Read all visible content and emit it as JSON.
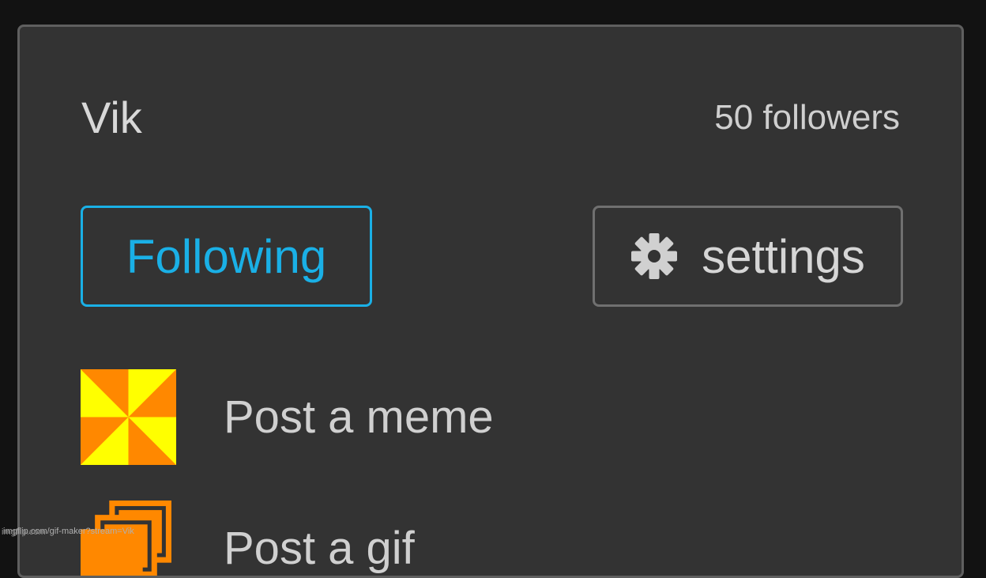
{
  "stream": {
    "title": "Vik",
    "followers": "50 followers"
  },
  "buttons": {
    "following_label": "Following",
    "settings_label": "settings",
    "settings_icon": "gear-icon"
  },
  "menu": {
    "items": [
      {
        "label": "Post a meme",
        "icon": "meme-generator-icon"
      },
      {
        "label": "Post a gif",
        "icon": "gif-maker-icon"
      }
    ]
  },
  "footer": {
    "watermark": "imgflip.com",
    "url": "imgflip.com/gif-maker?stream=Vik"
  },
  "colors": {
    "page_background": "#121212",
    "panel_background": "#333333",
    "panel_border": "#5f5f5f",
    "accent_blue": "#1ab0e6",
    "text_light": "#d0d0d0",
    "icon_orange": "#ff8800",
    "icon_yellow": "#ffff00"
  }
}
